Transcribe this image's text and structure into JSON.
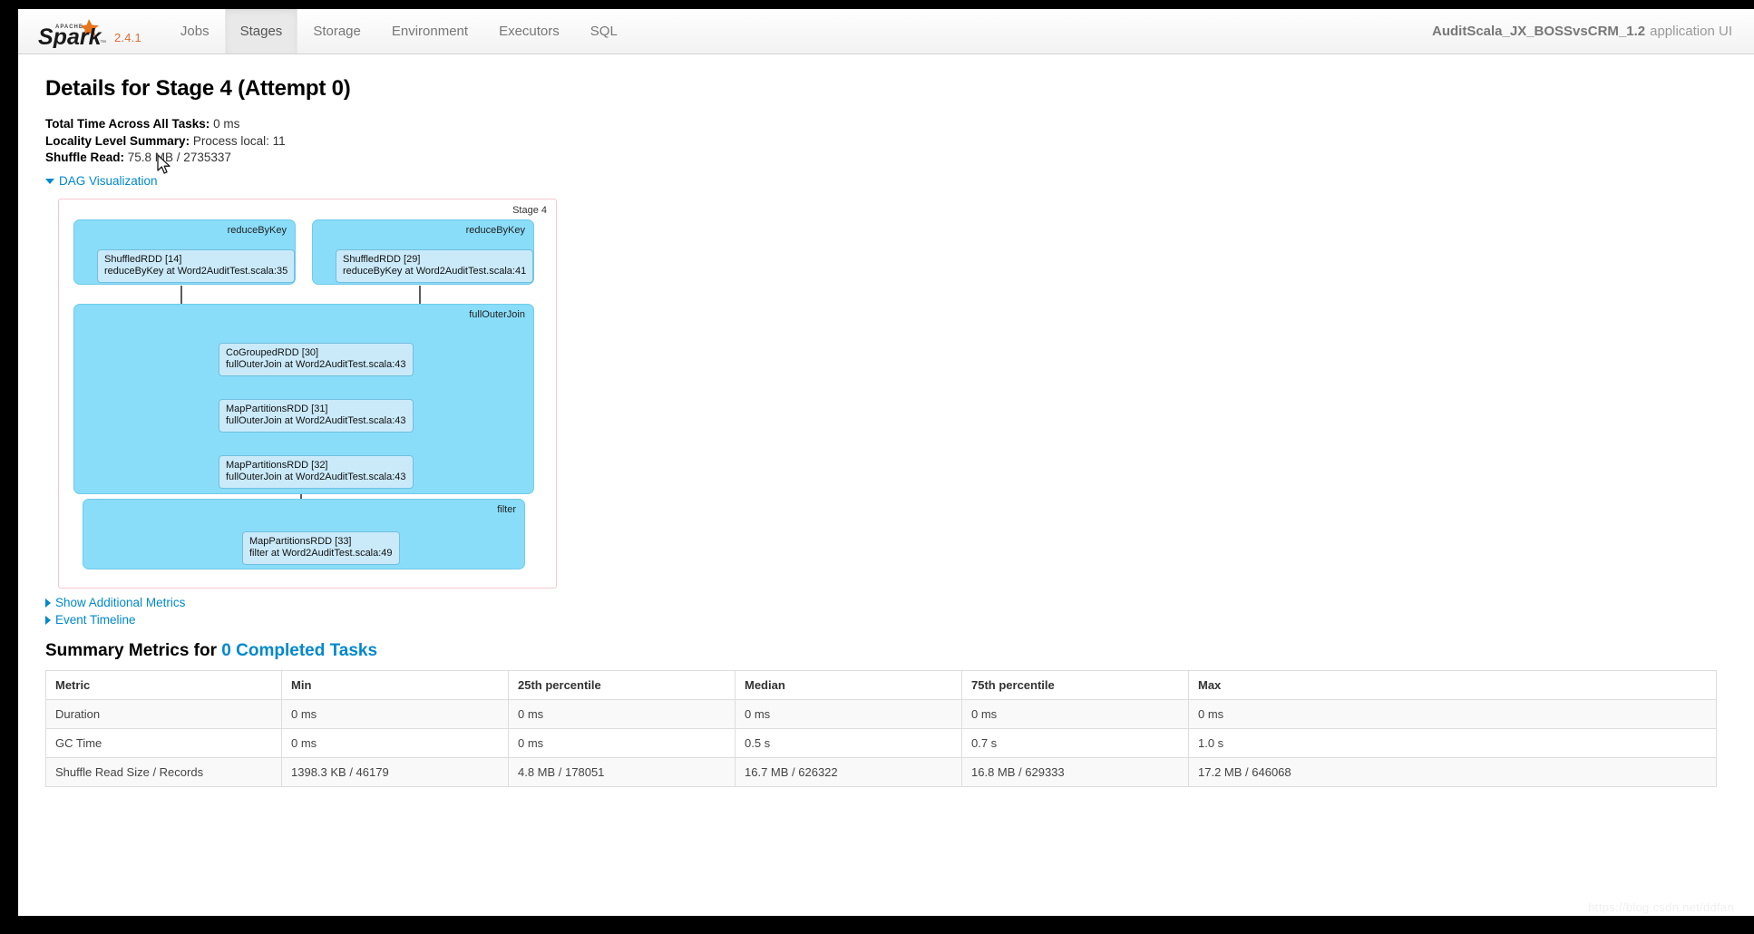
{
  "navbar": {
    "logo_alt": "Apache Spark",
    "logo_apache_text": "APACHE",
    "logo_word": "Spark",
    "version": "2.4.1",
    "tabs": [
      {
        "label": "Jobs",
        "active": false
      },
      {
        "label": "Stages",
        "active": true
      },
      {
        "label": "Storage",
        "active": false
      },
      {
        "label": "Environment",
        "active": false
      },
      {
        "label": "Executors",
        "active": false
      },
      {
        "label": "SQL",
        "active": false
      }
    ],
    "app_name": "AuditScala_JX_BOSSvsCRM_1.2",
    "app_suffix": "application UI"
  },
  "page": {
    "title": "Details for Stage 4 (Attempt 0)",
    "stats": [
      {
        "label": "Total Time Across All Tasks:",
        "value": "0 ms"
      },
      {
        "label": "Locality Level Summary:",
        "value": "Process local: 11"
      },
      {
        "label": "Shuffle Read:",
        "value": "75.8 MB / 2735337"
      }
    ],
    "dag_toggle_label": "DAG Visualization",
    "show_additional_metrics_label": "Show Additional Metrics",
    "event_timeline_label": "Event Timeline",
    "watermark": "https://blog.csdn.net/ddfan"
  },
  "dag": {
    "stage_label": "Stage 4",
    "scopes": [
      {
        "name": "reduceByKey"
      },
      {
        "name": "reduceByKey"
      },
      {
        "name": "fullOuterJoin"
      },
      {
        "name": "filter"
      }
    ],
    "nodes": [
      {
        "title": "ShuffledRDD [14]",
        "subtitle": "reduceByKey at Word2AuditTest.scala:35"
      },
      {
        "title": "ShuffledRDD [29]",
        "subtitle": "reduceByKey at Word2AuditTest.scala:41"
      },
      {
        "title": "CoGroupedRDD [30]",
        "subtitle": "fullOuterJoin at Word2AuditTest.scala:43"
      },
      {
        "title": "MapPartitionsRDD [31]",
        "subtitle": "fullOuterJoin at Word2AuditTest.scala:43"
      },
      {
        "title": "MapPartitionsRDD [32]",
        "subtitle": "fullOuterJoin at Word2AuditTest.scala:43"
      },
      {
        "title": "MapPartitionsRDD [33]",
        "subtitle": "filter at Word2AuditTest.scala:49"
      }
    ]
  },
  "summary_metrics": {
    "heading_prefix": "Summary Metrics for",
    "heading_link": "0 Completed Tasks",
    "columns": [
      "Metric",
      "Min",
      "25th percentile",
      "Median",
      "75th percentile",
      "Max"
    ],
    "rows": [
      [
        "Duration",
        "0 ms",
        "0 ms",
        "0 ms",
        "0 ms",
        "0 ms"
      ],
      [
        "GC Time",
        "0 ms",
        "0 ms",
        "0.5 s",
        "0.7 s",
        "1.0 s"
      ],
      [
        "Shuffle Read Size / Records",
        "1398.3 KB / 46179",
        "4.8 MB / 178051",
        "16.7 MB / 626322",
        "16.8 MB / 629333",
        "17.2 MB / 646068"
      ]
    ]
  },
  "colors": {
    "link": "#0088cc",
    "accent_orange": "#d9703a",
    "scope_fill": "#89ddf9",
    "node_fill": "#caeaf9",
    "stage_border": "#f2c7cf"
  }
}
